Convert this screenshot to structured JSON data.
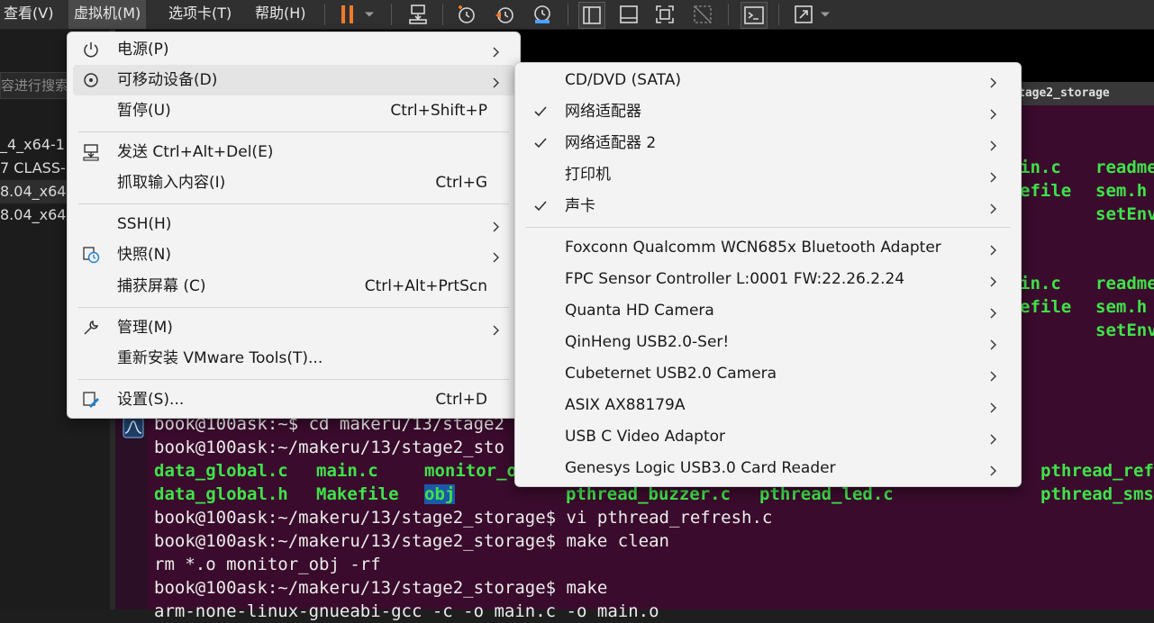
{
  "menubar": {
    "items": [
      {
        "label": "查看(V)"
      },
      {
        "label": "虚拟机(M)"
      },
      {
        "label": "选项卡(T)"
      },
      {
        "label": "帮助(H)"
      }
    ]
  },
  "toolbar": {
    "icons": [
      "pause-icon",
      "dropdown-arrow-icon",
      "send-to-icon",
      "snapshot-take-icon",
      "snapshot-revert-icon",
      "snapshot-manager-icon",
      "library-view-icon",
      "thumbnail-view-icon",
      "fullscreen-icon",
      "unity-icon",
      "console-icon",
      "stretch-icon",
      "dropdown-arrow-icon"
    ],
    "accent_color": "#f07a2a"
  },
  "library": {
    "search_placeholder": "容进行搜索",
    "items": [
      {
        "label": "_4_x64-1"
      },
      {
        "label": "7 CLASS-"
      },
      {
        "label": "8.04_x64"
      },
      {
        "label": "8.04_x64"
      }
    ]
  },
  "vm_tab": {
    "title": "tage2_storage"
  },
  "terminal": {
    "lines": [
      {
        "text": "book@100ask:~$ cd makeru/13/stage2"
      },
      {
        "text": "book@100ask:~/makeru/13/stage2_sto"
      },
      {
        "text": "book@100ask:~/makeru/13/stage2_storage$ vi pthread_refresh.c"
      },
      {
        "text": "book@100ask:~/makeru/13/stage2_storage$ make clean"
      },
      {
        "text": "rm *.o monitor_obj -rf"
      },
      {
        "text": "book@100ask:~/makeru/13/stage2_storage$ make"
      },
      {
        "text": "arm-none-linux-gnueabi-gcc -c -o main.c -o main.o"
      }
    ],
    "files_row1": [
      "data_global.c",
      "main.c",
      "monitor_o",
      "pthread_ref"
    ],
    "files_row2": [
      "data_global.h",
      "Makefile",
      "obj",
      "pthread_buzzer.c",
      "pthread_led.c",
      "pthread_sms"
    ],
    "right_col": [
      "in.c",
      "readme",
      "efile",
      "sem.h",
      "setEnv",
      "in.c",
      "readme",
      "efile",
      "sem.h",
      "setEnv"
    ],
    "file_color": "#3fe34a",
    "bg_color": "#3a0b2c"
  },
  "vm_menu": {
    "items": [
      {
        "label": "电源(P)",
        "icon": "power-icon"
      },
      {
        "label": "可移动设备(D)",
        "icon": "removable-device-icon"
      },
      {
        "label": "暂停(U)",
        "shortcut": "Ctrl+Shift+P"
      },
      {
        "label": "发送 Ctrl+Alt+Del(E)",
        "icon": "send-keys-icon"
      },
      {
        "label": "抓取输入内容(I)",
        "shortcut": "Ctrl+G"
      },
      {
        "label": "SSH(H)"
      },
      {
        "label": "快照(N)",
        "icon": "snapshot-icon"
      },
      {
        "label": "捕获屏幕 (C)",
        "shortcut": "Ctrl+Alt+PrtScn"
      },
      {
        "label": "管理(M)",
        "icon": "wrench-icon"
      },
      {
        "label": "重新安装 VMware Tools(T)..."
      },
      {
        "label": "设置(S)...",
        "icon": "settings-icon",
        "shortcut": "Ctrl+D"
      }
    ]
  },
  "devices_menu": {
    "items": [
      {
        "label": "CD/DVD (SATA)",
        "checked": false
      },
      {
        "label": "网络适配器",
        "checked": true
      },
      {
        "label": "网络适配器 2",
        "checked": true
      },
      {
        "label": "打印机",
        "checked": false
      },
      {
        "label": "声卡",
        "checked": true
      },
      {
        "label": "Foxconn Qualcomm WCN685x Bluetooth Adapter",
        "checked": false
      },
      {
        "label": "FPC Sensor Controller L:0001 FW:22.26.2.24",
        "checked": false
      },
      {
        "label": "Quanta HD Camera",
        "checked": false
      },
      {
        "label": "QinHeng USB2.0-Ser!",
        "checked": false
      },
      {
        "label": "Cubeternet USB2.0 Camera",
        "checked": false
      },
      {
        "label": "ASIX AX88179A",
        "checked": false
      },
      {
        "label": "USB C Video Adaptor",
        "checked": false
      },
      {
        "label": "Genesys Logic USB3.0 Card Reader",
        "checked": false
      }
    ]
  }
}
